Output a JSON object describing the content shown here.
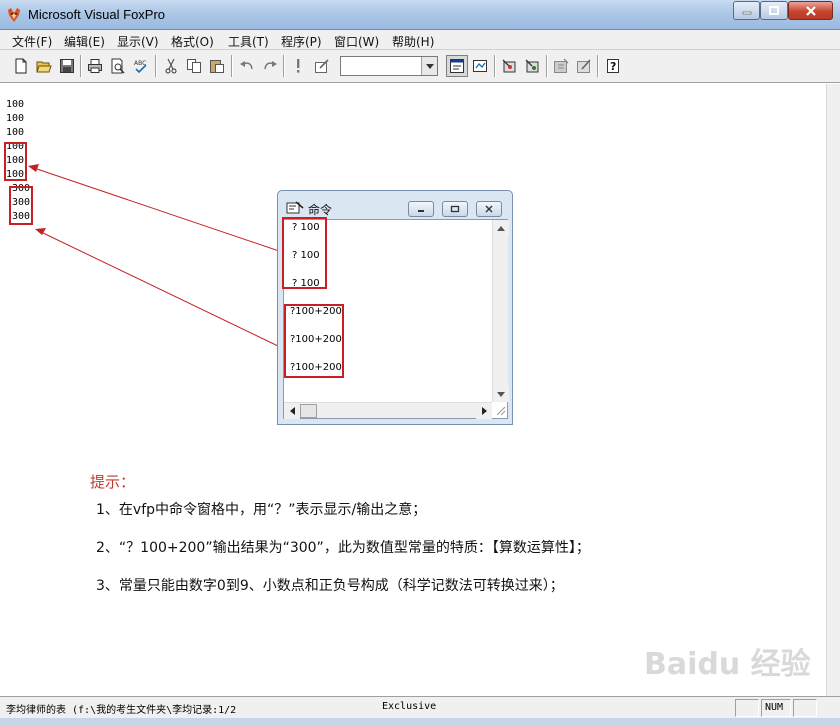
{
  "window": {
    "title": "Microsoft Visual FoxPro",
    "minimize_label": "minimize",
    "maximize_label": "maximize",
    "close_label": "close"
  },
  "menu": [
    {
      "label": "文件(F)"
    },
    {
      "label": "编辑(E)"
    },
    {
      "label": "显示(V)"
    },
    {
      "label": "格式(O)"
    },
    {
      "label": "工具(T)"
    },
    {
      "label": "程序(P)"
    },
    {
      "label": "窗口(W)"
    },
    {
      "label": "帮助(H)"
    }
  ],
  "toolbar": {
    "icons": [
      "new-icon",
      "open-icon",
      "save-icon",
      "print-icon",
      "print-preview-icon",
      "spelling-icon",
      "cut-icon",
      "copy-icon",
      "paste-icon",
      "undo-icon",
      "redo-icon",
      "run-icon",
      "modify-form-icon",
      "command-window-icon",
      "data-session-icon",
      "form-wizard-icon",
      "database-icon",
      "class-browser-icon",
      "component-gallery-icon",
      "help-icon"
    ],
    "combo_value": ""
  },
  "output_lines": [
    "100",
    "100",
    "100",
    "100",
    "100",
    "100",
    "300",
    "300",
    "300"
  ],
  "command_window": {
    "title": "命令",
    "lines": [
      "? 100",
      "? 100",
      "? 100",
      "?100+200",
      "?100+200",
      "?100+200"
    ]
  },
  "tips": {
    "title": "提示：",
    "items": [
      "1、在vfp中命令窗格中，用“？”表示显示/输出之意；",
      "2、“？100+200”输出结果为“300”，此为数值型常量的特质：【算数运算性】；",
      "3、常量只能由数字0到9、小数点和正负号构成（科学记数法可转换过来）；"
    ]
  },
  "statusbar": {
    "table_info": "李均律师的表 (f:\\我的考生文件夹\\李均记录:1/2",
    "mode": "Exclusive",
    "numlock": "NUM"
  },
  "watermark": {
    "text": "Baidu 经验"
  },
  "colors": {
    "annotation_red": "#c62024",
    "tips_title": "#c0392b"
  }
}
